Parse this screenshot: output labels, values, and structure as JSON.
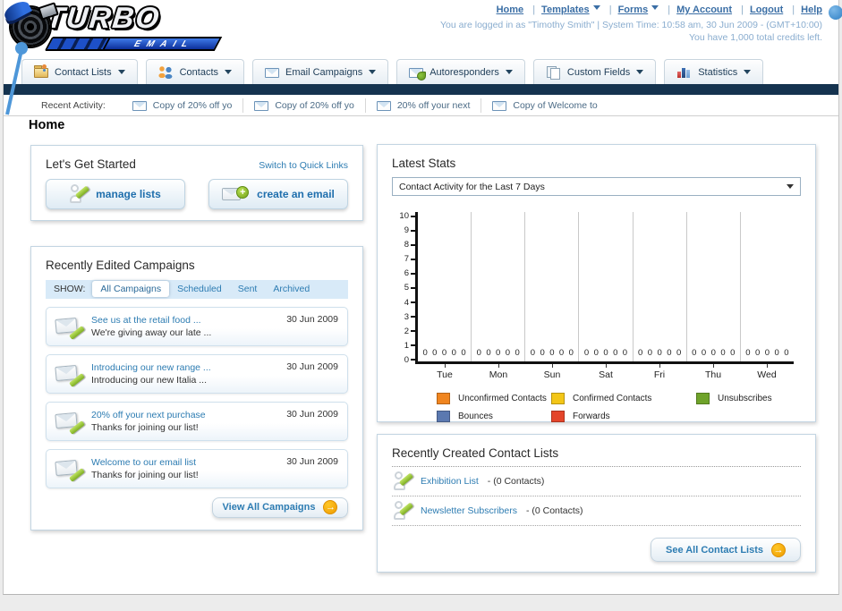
{
  "logo": {
    "title": "TURBO",
    "subtitle": "EMAIL"
  },
  "header": {
    "links": [
      {
        "label": "Home",
        "dropdown": false
      },
      {
        "label": "Templates",
        "dropdown": true
      },
      {
        "label": "Forms",
        "dropdown": true
      },
      {
        "label": "My Account",
        "dropdown": false
      },
      {
        "label": "Logout",
        "dropdown": false
      },
      {
        "label": "Help",
        "dropdown": false
      }
    ],
    "status_line1": "You are logged in as \"Timothy Smith\" | System Time: 10:58 am, 30 Jun 2009 - (GMT+10:00)",
    "status_line2": "You have 1,000 total credits left."
  },
  "nav": {
    "tabs": [
      {
        "label": "Contact Lists",
        "icon": "contact-lists"
      },
      {
        "label": "Contacts",
        "icon": "contacts"
      },
      {
        "label": "Email Campaigns",
        "icon": "email-campaigns"
      },
      {
        "label": "Autoresponders",
        "icon": "autoresponders"
      },
      {
        "label": "Custom Fields",
        "icon": "custom-fields"
      },
      {
        "label": "Statistics",
        "icon": "statistics"
      }
    ]
  },
  "recent_activity": {
    "label": "Recent Activity:",
    "items": [
      "Copy of 20% off yo",
      "Copy of 20% off yo",
      "20% off your next",
      "Copy of Welcome to"
    ]
  },
  "page": {
    "title": "Home"
  },
  "get_started": {
    "title": "Let's Get Started",
    "switch_link": "Switch to Quick Links",
    "manage_lists_label": "manage lists",
    "create_email_label": "create an email"
  },
  "campaigns": {
    "title": "Recently Edited Campaigns",
    "show_label": "SHOW:",
    "tabs": [
      {
        "label": "All Campaigns",
        "selected": true
      },
      {
        "label": "Scheduled",
        "selected": false
      },
      {
        "label": "Sent",
        "selected": false
      },
      {
        "label": "Archived",
        "selected": false
      }
    ],
    "items": [
      {
        "title": "See us at the retail food ...",
        "subtitle": "We're giving away our late ...",
        "date": "30 Jun 2009"
      },
      {
        "title": "Introducing our new range ...",
        "subtitle": "Introducing our new Italia ...",
        "date": "30 Jun 2009"
      },
      {
        "title": "20% off your next purchase",
        "subtitle": "Thanks for joining our list!",
        "date": "30 Jun 2009"
      },
      {
        "title": "Welcome to our email list",
        "subtitle": "Thanks for joining our list!",
        "date": "30 Jun 2009"
      }
    ],
    "view_all_label": "View All Campaigns"
  },
  "stats": {
    "title": "Latest Stats",
    "period_selected": "Contact Activity for the Last 7 Days"
  },
  "chart_data": {
    "type": "bar",
    "title": "Contact Activity for the Last 7 Days",
    "categories": [
      "Tue",
      "Mon",
      "Sun",
      "Sat",
      "Fri",
      "Thu",
      "Wed"
    ],
    "series": [
      {
        "name": "Unconfirmed Contacts",
        "color": "#f0851f",
        "values": [
          0,
          0,
          0,
          0,
          0,
          0,
          0
        ]
      },
      {
        "name": "Confirmed Contacts",
        "color": "#f3c617",
        "values": [
          0,
          0,
          0,
          0,
          0,
          0,
          0
        ]
      },
      {
        "name": "Unsubscribes",
        "color": "#6fa32a",
        "values": [
          0,
          0,
          0,
          0,
          0,
          0,
          0
        ]
      },
      {
        "name": "Bounces",
        "color": "#5b79b0",
        "values": [
          0,
          0,
          0,
          0,
          0,
          0,
          0
        ]
      },
      {
        "name": "Forwards",
        "color": "#e4452a",
        "values": [
          0,
          0,
          0,
          0,
          0,
          0,
          0
        ]
      }
    ],
    "ylim": [
      0,
      10
    ],
    "yticks": [
      10,
      9,
      8,
      7,
      6,
      5,
      4,
      3,
      2,
      1,
      0
    ],
    "grid": "vertical-only",
    "legend_position": "bottom"
  },
  "contact_lists": {
    "title": "Recently Created Contact Lists",
    "items": [
      {
        "name": "Exhibition List",
        "detail": "- (0 Contacts)"
      },
      {
        "name": "Newsletter Subscribers",
        "detail": "- (0 Contacts)"
      }
    ],
    "see_all_label": "See All Contact Lists"
  }
}
